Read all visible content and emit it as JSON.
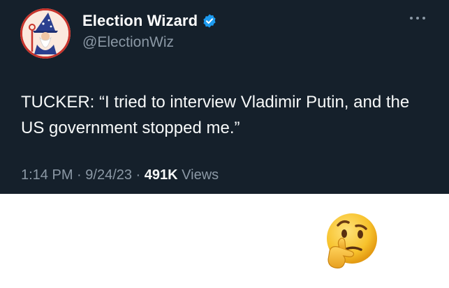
{
  "tweet": {
    "display_name": "Election Wizard",
    "handle": "@ElectionWiz",
    "text": "TUCKER: “I tried to interview Vladimir Putin, and the US government stopped me.”",
    "time": "1:14 PM",
    "separator": " · ",
    "date": "9/24/23",
    "views_count": "491K",
    "views_label": " Views",
    "verified": true
  },
  "icons": {
    "avatar": "wizard-avatar",
    "badge": "verified-badge-icon",
    "menu": "more-options-icon",
    "reaction": "thinking-face-emoji"
  },
  "colors": {
    "background": "#15202b",
    "text": "#f7f9f9",
    "secondary": "#8b98a5",
    "verified": "#1d9bf0",
    "below": "#ffffff"
  }
}
